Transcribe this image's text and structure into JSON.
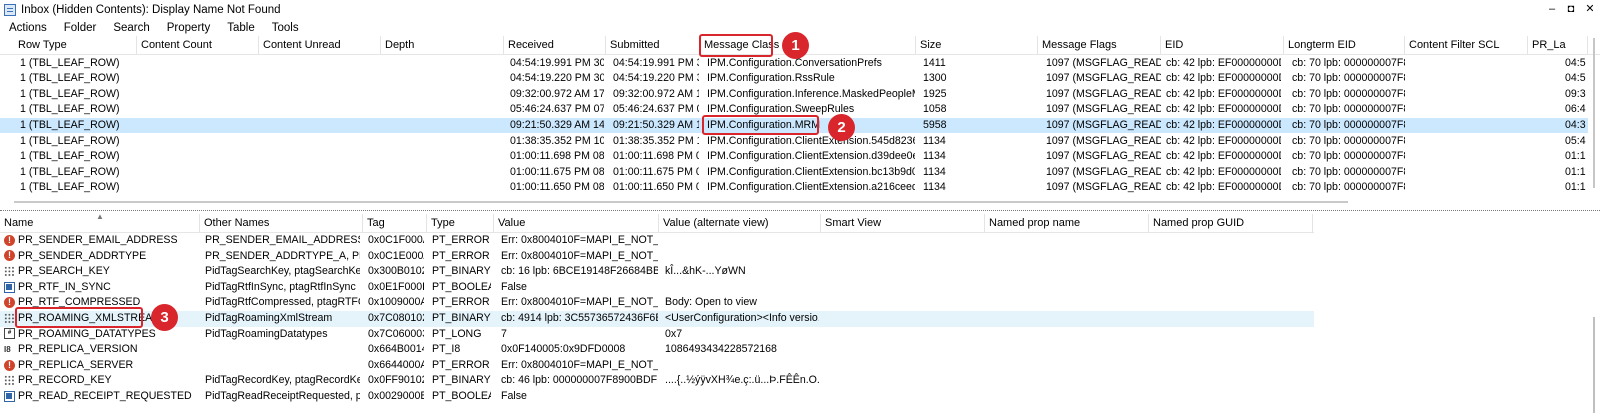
{
  "window": {
    "title": "Inbox (Hidden Contents): Display Name Not Found",
    "controls": [
      "–",
      "◘",
      "✕"
    ]
  },
  "menu": [
    "Actions",
    "Folder",
    "Search",
    "Property",
    "Table",
    "Tools"
  ],
  "top_table": {
    "columns": [
      "Row Type",
      "Content Count",
      "Content Unread",
      "Depth",
      "Received",
      "Submitted",
      "Message Class",
      "Size",
      "Message Flags",
      "EID",
      "Longterm EID",
      "Content Filter SCL",
      "PR_La"
    ],
    "rows": [
      [
        "1 (TBL_LEAF_ROW)",
        "",
        "",
        "",
        "04:54:19.991 PM 30...",
        "04:54:19.991 PM 3...",
        "IPM.Configuration.ConversationPrefs",
        "1411",
        "1097 (MSGFLAG_READ | ...",
        "cb: 42 lpb: EF00000000D...",
        "cb: 70 lpb: 000000007F89...",
        "",
        "04:5"
      ],
      [
        "1 (TBL_LEAF_ROW)",
        "",
        "",
        "",
        "04:54:19.220 PM 30...",
        "04:54:19.220 PM 3...",
        "IPM.Configuration.RssRule",
        "1300",
        "1097 (MSGFLAG_READ | ...",
        "cb: 42 lpb: EF00000000D...",
        "cb: 70 lpb: 000000007F89...",
        "",
        "04:5"
      ],
      [
        "1 (TBL_LEAF_ROW)",
        "",
        "",
        "",
        "09:32:00.972 AM 17...",
        "09:32:00.972 AM 1...",
        "IPM.Configuration.Inference.MaskedPeopleM...",
        "1925",
        "1097 (MSGFLAG_READ | ...",
        "cb: 42 lpb: EF00000000D...",
        "cb: 70 lpb: 000000007F89...",
        "",
        "09:3"
      ],
      [
        "1 (TBL_LEAF_ROW)",
        "",
        "",
        "",
        "05:46:24.637 PM 07...",
        "05:46:24.637 PM 0...",
        "IPM.Configuration.SweepRules",
        "1058",
        "1097 (MSGFLAG_READ | ...",
        "cb: 42 lpb: EF00000000D...",
        "cb: 70 lpb: 000000007F89...",
        "",
        "06:4"
      ],
      [
        "1 (TBL_LEAF_ROW)",
        "",
        "",
        "",
        "09:21:50.329 AM 14...",
        "09:21:50.329 AM 1...",
        "IPM.Configuration.MRM",
        "5958",
        "1097 (MSGFLAG_READ | ...",
        "cb: 42 lpb: EF00000000D...",
        "cb: 70 lpb: 000000007F89...",
        "",
        "04:3"
      ],
      [
        "1 (TBL_LEAF_ROW)",
        "",
        "",
        "",
        "01:38:35.352 PM 10...",
        "01:38:35.352 PM 1...",
        "IPM.Configuration.ClientExtension.545d82367...",
        "1134",
        "1097 (MSGFLAG_READ | ...",
        "cb: 42 lpb: EF00000000D...",
        "cb: 70 lpb: 000000007F89...",
        "",
        "05:4"
      ],
      [
        "1 (TBL_LEAF_ROW)",
        "",
        "",
        "",
        "01:00:11.698 PM 08...",
        "01:00:11.698 PM 0...",
        "IPM.Configuration.ClientExtension.d39dee0ef...",
        "1134",
        "1097 (MSGFLAG_READ | ...",
        "cb: 42 lpb: EF00000000D...",
        "cb: 70 lpb: 000000007F89...",
        "",
        "01:1"
      ],
      [
        "1 (TBL_LEAF_ROW)",
        "",
        "",
        "",
        "01:00:11.675 PM 08...",
        "01:00:11.675 PM 0...",
        "IPM.Configuration.ClientExtension.bc13b9d05...",
        "1134",
        "1097 (MSGFLAG_READ | ...",
        "cb: 42 lpb: EF00000000D...",
        "cb: 70 lpb: 000000007F89...",
        "",
        "01:1"
      ],
      [
        "1 (TBL_LEAF_ROW)",
        "",
        "",
        "",
        "01:00:11.650 PM 08...",
        "01:00:11.650 PM 0...",
        "IPM.Configuration.ClientExtension.a216ceed7...",
        "1134",
        "1097 (MSGFLAG_READ | ...",
        "cb: 42 lpb: EF00000000D...",
        "cb: 70 lpb: 000000007F89...",
        "",
        "01:1"
      ]
    ],
    "selected_index": 4
  },
  "bottom_table": {
    "columns": [
      "Name",
      "Other Names",
      "Tag",
      "Type",
      "Value",
      "Value (alternate view)",
      "Smart View",
      "Named prop name",
      "Named prop GUID"
    ],
    "rows": [
      {
        "icon": "error-icon",
        "cells": [
          "PR_SENDER_EMAIL_ADDRESS",
          "PR_SENDER_EMAIL_ADDRESS_A, ...",
          "0x0C1F000A",
          "PT_ERROR",
          "Err: 0x8004010F=MAPI_E_NOT_FO...",
          "",
          "",
          "",
          ""
        ]
      },
      {
        "icon": "error-icon",
        "cells": [
          "PR_SENDER_ADDRTYPE",
          "PR_SENDER_ADDRTYPE_A, PR_SE...",
          "0x0C1E000A",
          "PT_ERROR",
          "Err: 0x8004010F=MAPI_E_NOT_FO...",
          "",
          "",
          "",
          ""
        ]
      },
      {
        "icon": "binary-icon",
        "cells": [
          "PR_SEARCH_KEY",
          "PidTagSearchKey, ptagSearchKey",
          "0x300B0102",
          "PT_BINARY",
          "cb: 16 lpb: 6BCE19148F26684BB70...",
          "kÎ...&hK-...YøWN",
          "",
          "",
          ""
        ]
      },
      {
        "icon": "boolean-icon",
        "cells": [
          "PR_RTF_IN_SYNC",
          "PidTagRtfInSync, ptagRtfInSync",
          "0x0E1F000B",
          "PT_BOOLEAN",
          "False",
          "",
          "",
          "",
          ""
        ]
      },
      {
        "icon": "error-icon",
        "cells": [
          "PR_RTF_COMPRESSED",
          "PidTagRtfCompressed, ptagRTFCo...",
          "0x1009000A",
          "PT_ERROR",
          "Err: 0x8004010F=MAPI_E_NOT_FO...",
          "Body: Open to view",
          "",
          "",
          ""
        ]
      },
      {
        "icon": "binary-icon",
        "cells": [
          "PR_ROAMING_XMLSTREAM",
          "PidTagRoamingXmlStream",
          "0x7C080102",
          "PT_BINARY",
          "cb: 4914 lpb: 3C55736572436F6E66...",
          "<UserConfiguration><Info versio...",
          "",
          "",
          ""
        ]
      },
      {
        "icon": "long-icon",
        "cells": [
          "PR_ROAMING_DATATYPES",
          "PidTagRoamingDatatypes",
          "0x7C060003",
          "PT_LONG",
          "7",
          "0x7",
          "",
          "",
          ""
        ]
      },
      {
        "icon": "i8-icon",
        "cells": [
          "PR_REPLICA_VERSION",
          "",
          "0x664B0014",
          "PT_I8",
          "0x0F140005:0x9DFD0008",
          "1086493434228572168",
          "",
          "",
          ""
        ]
      },
      {
        "icon": "error-icon",
        "cells": [
          "PR_REPLICA_SERVER",
          "",
          "0x6644000A",
          "PT_ERROR",
          "Err: 0x8004010F=MAPI_E_NOT_FO...",
          "",
          "",
          "",
          ""
        ]
      },
      {
        "icon": "binary-icon",
        "cells": [
          "PR_RECORD_KEY",
          "PidTagRecordKey, ptagRecordKey",
          "0x0FF90102",
          "PT_BINARY",
          "cb: 46 lpb: 000000007F8900BDFF7...",
          "....{..½ýÿvXH¾e.ç:.ü...Þ.FÊÊn.O..³⁄z...",
          "",
          "",
          ""
        ]
      },
      {
        "icon": "boolean-icon",
        "cells": [
          "PR_READ_RECEIPT_REQUESTED",
          "PidTagReadReceiptRequested, pta...",
          "0x0029000B",
          "PT_BOOLEAN",
          "False",
          "",
          "",
          "",
          ""
        ]
      }
    ],
    "highlight_index": 5
  },
  "callouts": [
    {
      "label": "1",
      "target": "Message Class header"
    },
    {
      "label": "2",
      "target": "IPM.Configuration.MRM"
    },
    {
      "label": "3",
      "target": "PR_ROAMING_XMLSTREAM"
    }
  ],
  "colors": {
    "accent": "#d9262c",
    "selection": "#cce8ff",
    "error": "#d0442b"
  }
}
